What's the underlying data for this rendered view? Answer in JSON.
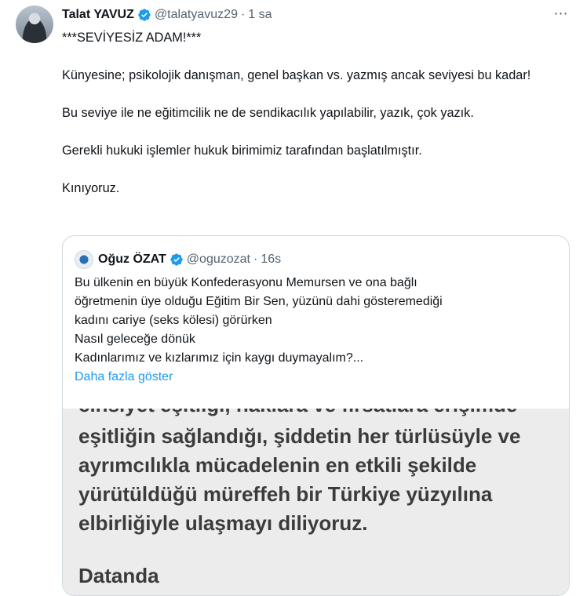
{
  "tweet": {
    "author_name": "Talat YAVUZ",
    "handle": "@talatyavuz29",
    "separator": "·",
    "time": "1 sa",
    "more_icon": "⋯",
    "paragraphs": [
      "***SEVİYESİZ ADAM!***",
      "Künyesine; psikolojik danışman, genel başkan vs. yazmış ancak  seviyesi bu kadar!",
      "Bu seviye ile ne eğitimcilik ne de sendikacılık yapılabilir, yazık, çok yazık.",
      "Gerekli hukuki işlemler hukuk birimimiz tarafından başlatılmıştır.",
      "Kınıyoruz."
    ]
  },
  "quoted_tweet": {
    "author_name": "Oğuz ÖZAT",
    "handle": "@oguzozat",
    "separator": "·",
    "time": "16s",
    "lines": [
      "Bu ülkenin en büyük Konfederasyonu Memursen ve ona bağlı",
      "öğretmenin üye olduğu Eğitim Bir Sen, yüzünü dahi gösteremediği",
      "kadını  cariye (seks kölesi) görürken",
      "Nasıl geleceğe dönük",
      "Kadınlarımız ve kızlarımız için kaygı duymayalım?..."
    ],
    "show_more": "Daha fazla göster",
    "image_lines": [
      "cinsiyet eşitliği, haklara ve fırsatlara erişimde",
      "eşitliğin sağlandığı, şiddetin her türlüsüyle ve",
      "ayrımcılıkla mücadelenin en etkili şekilde",
      "yürütüldüğü müreffeh bir Türkiye yüzyılına",
      "elbirliğiyle ulaşmayı diliyoruz.",
      "Datanda"
    ]
  },
  "colors": {
    "text": "#0f1419",
    "secondary": "#536471",
    "link": "#1d9bf0",
    "border": "#cfd9de",
    "verified": "#1d9bf0"
  }
}
